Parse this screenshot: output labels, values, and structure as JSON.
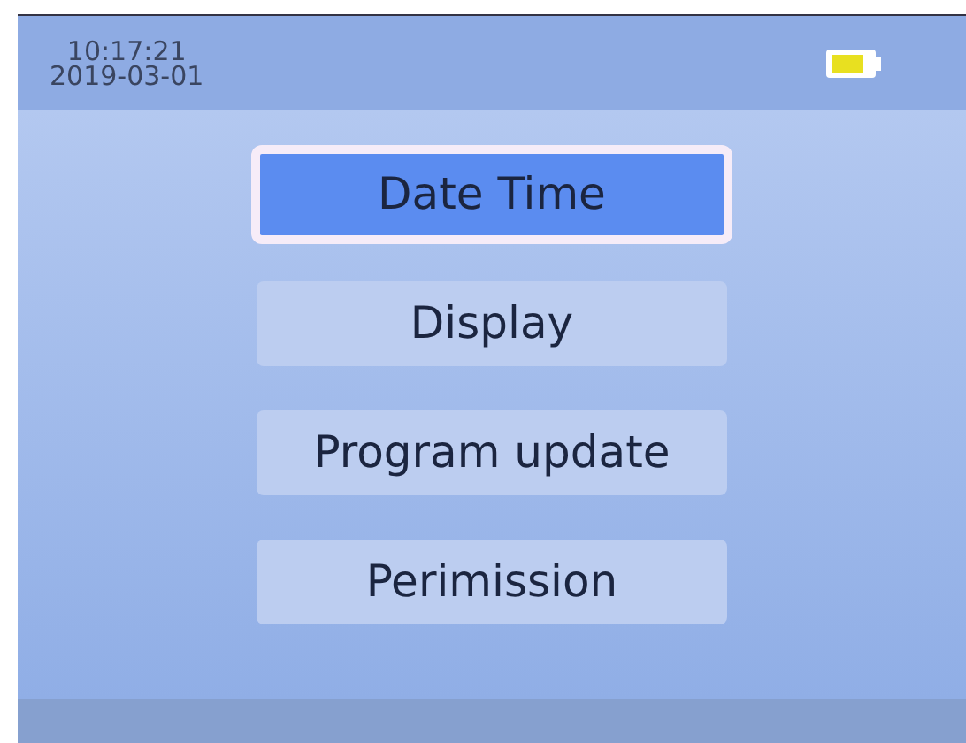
{
  "status_bar": {
    "time": "10:17:21",
    "date": "2019-03-01"
  },
  "menu": [
    {
      "label": "Date Time",
      "selected": true
    },
    {
      "label": "Display",
      "selected": false
    },
    {
      "label": "Program update",
      "selected": false
    },
    {
      "label": "Perimission",
      "selected": false
    }
  ]
}
